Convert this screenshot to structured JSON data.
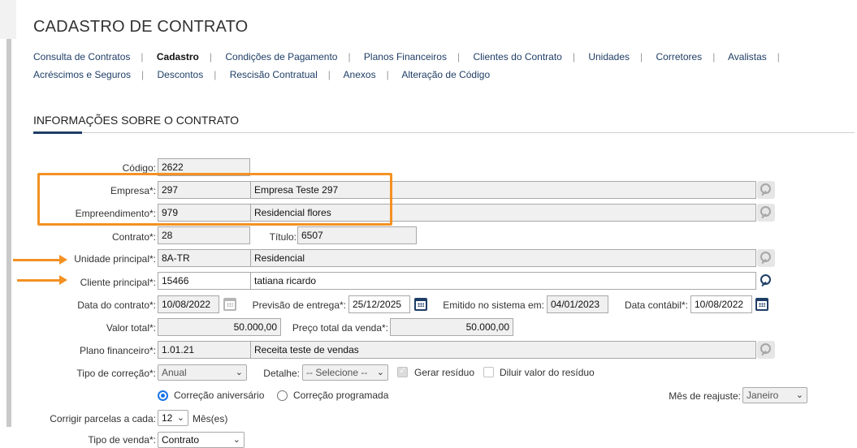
{
  "page": {
    "title": "CADASTRO DE CONTRATO",
    "section_title": "INFORMAÇÕES SOBRE O CONTRATO"
  },
  "nav": [
    "Consulta de Contratos",
    "Cadastro",
    "Condições de Pagamento",
    "Planos Financeiros",
    "Clientes do Contrato",
    "Unidades",
    "Corretores",
    "Avalistas",
    "Acréscimos e Seguros",
    "Descontos",
    "Rescisão Contratual",
    "Anexos",
    "Alteração de Código"
  ],
  "nav_active": "Cadastro",
  "form": {
    "codigo": {
      "label": "Código:",
      "value": "2622"
    },
    "empresa": {
      "label": "Empresa*:",
      "code": "297",
      "name": "Empresa Teste 297"
    },
    "empreendimento": {
      "label": "Empreendimento*:",
      "code": "979",
      "name": "Residencial flores"
    },
    "contrato": {
      "label": "Contrato*:",
      "value": "28"
    },
    "titulo": {
      "label": "Título:",
      "value": "6507"
    },
    "unidade": {
      "label": "Unidade principal*:",
      "code": "8A-TR",
      "name": "Residencial"
    },
    "cliente": {
      "label": "Cliente principal*:",
      "code": "15466",
      "name": "tatiana  ricardo"
    },
    "data_contrato": {
      "label": "Data do contrato*:",
      "value": "10/08/2022"
    },
    "previsao": {
      "label": "Previsão de entrega*:",
      "value": "25/12/2025"
    },
    "emitido": {
      "label": "Emitido no sistema em:",
      "value": "04/01/2023"
    },
    "data_contabil": {
      "label": "Data contábil*:",
      "value": "10/08/2022"
    },
    "valor_total": {
      "label": "Valor total*:",
      "value": "50.000,00"
    },
    "preco_total": {
      "label": "Preço total da venda*:",
      "value": "50.000,00"
    },
    "plano": {
      "label": "Plano financeiro*:",
      "code": "1.01.21",
      "name": "Receita teste de vendas"
    },
    "tipo_correcao": {
      "label": "Tipo de correção*:",
      "value": "Anual"
    },
    "detalhe": {
      "label": "Detalhe:",
      "value": "-- Selecione --"
    },
    "gerar_residuo": {
      "label": "Gerar resíduo",
      "checked": true
    },
    "diluir": {
      "label": "Diluir valor do resíduo",
      "checked": false
    },
    "correcao_aniversario": {
      "label": "Correção aniversário",
      "selected": true
    },
    "correcao_programada": {
      "label": "Correção programada",
      "selected": false
    },
    "mes_reajuste": {
      "label": "Mês de reajuste:",
      "value": "Janeiro"
    },
    "corrigir": {
      "label": "Corrigir parcelas a cada:",
      "value": "12",
      "unit": "Mês(es)"
    },
    "tipo_venda": {
      "label": "Tipo de venda*:",
      "value": "Contrato"
    }
  },
  "colors": {
    "highlight": "#f39123",
    "accent": "#1f3e66",
    "radio": "#1a73e8"
  },
  "icons": [
    "search-icon",
    "calendar-icon",
    "chevron-down-icon",
    "arrow-right-icon"
  ]
}
